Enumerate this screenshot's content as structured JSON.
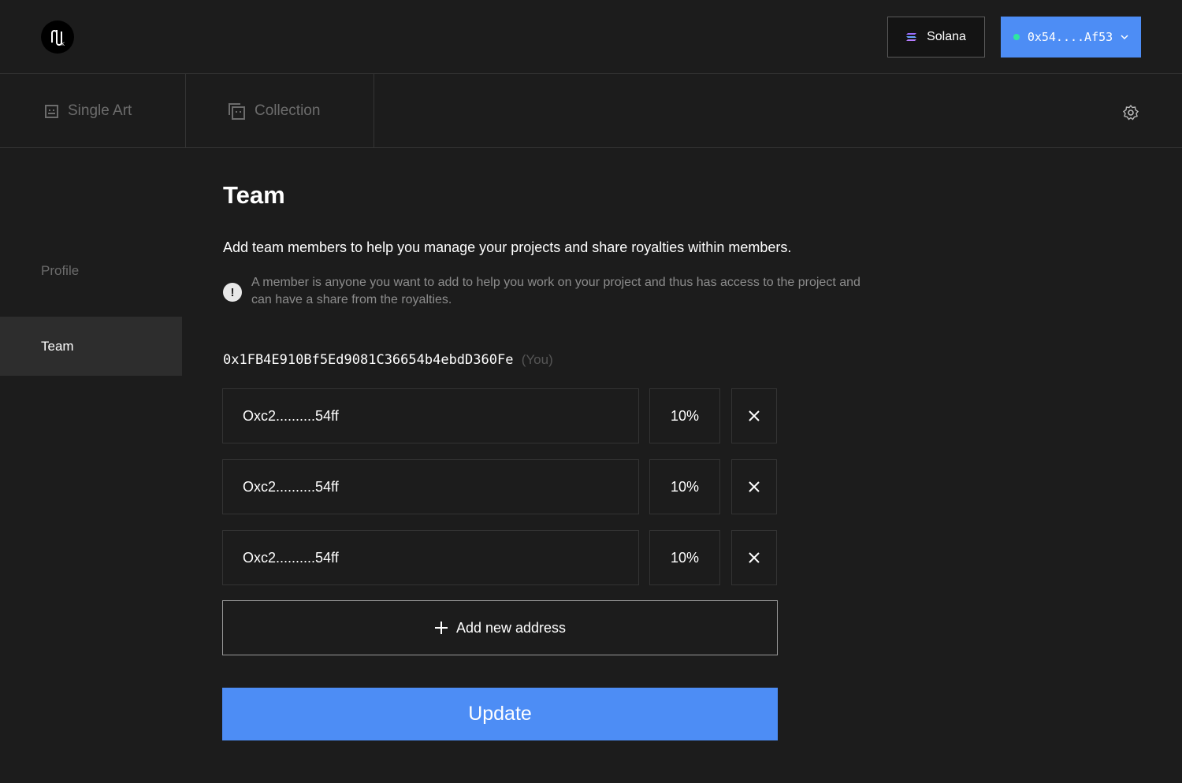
{
  "header": {
    "network_label": "Solana",
    "wallet_label": "0x54....Af53",
    "wallet_status_color": "#2ee6a0",
    "accent_color": "#4d8df5"
  },
  "tabs": [
    {
      "label": "Single Art",
      "icon": "single-art-icon"
    },
    {
      "label": "Collection",
      "icon": "collection-icon"
    }
  ],
  "sidebar": {
    "items": [
      {
        "label": "Profile",
        "active": false
      },
      {
        "label": "Team",
        "active": true
      }
    ]
  },
  "main": {
    "title": "Team",
    "description": "Add team members to help you manage your projects and share royalties within members.",
    "note": "A member is anyone you want to add to help you work on your project and thus has access to the project and can have a share from the royalties.",
    "owner_address": "0x1FB4E910Bf5Ed9081C36654b4ebdD360Fe",
    "owner_suffix": "(You)",
    "members": [
      {
        "address": "Oxc2..........54ff",
        "share": "10%"
      },
      {
        "address": "Oxc2..........54ff",
        "share": "10%"
      },
      {
        "address": "Oxc2..........54ff",
        "share": "10%"
      }
    ],
    "add_label": "Add new address",
    "update_label": "Update"
  }
}
